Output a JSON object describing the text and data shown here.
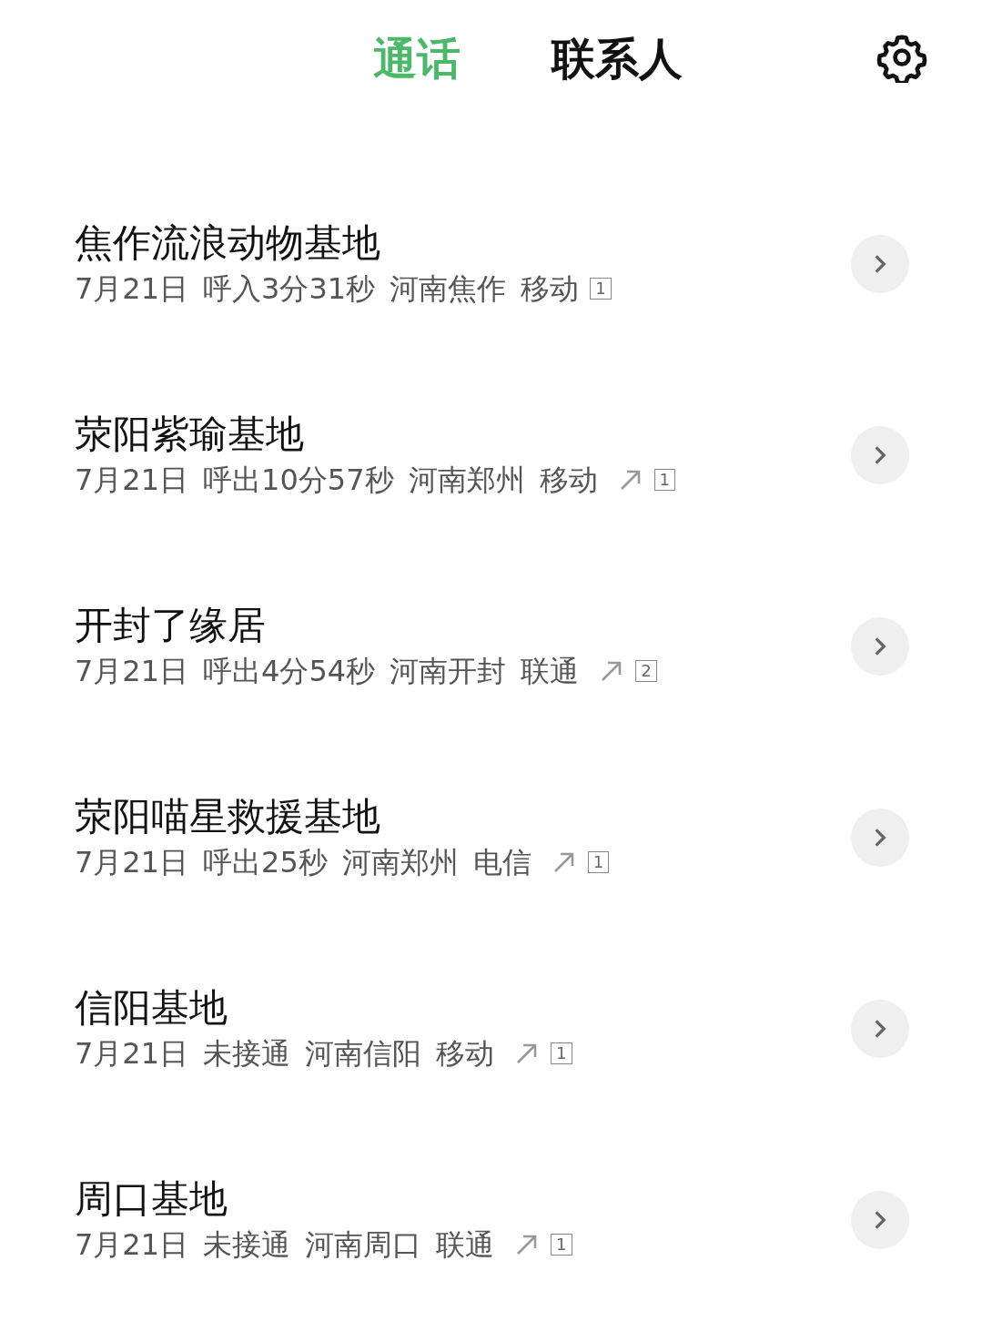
{
  "tabs": [
    {
      "label": "通话",
      "selected": true
    },
    {
      "label": "联系人",
      "selected": false
    }
  ],
  "calls": [
    {
      "name": "焦作流浪动物基地",
      "date": "7月21日",
      "status": "呼入3分31秒",
      "location": "河南焦作",
      "carrier": "移动",
      "outgoing": false,
      "sim": "1"
    },
    {
      "name": "荥阳紫瑜基地",
      "date": "7月21日",
      "status": "呼出10分57秒",
      "location": "河南郑州",
      "carrier": "移动",
      "outgoing": true,
      "sim": "1"
    },
    {
      "name": "开封了缘居",
      "date": "7月21日",
      "status": "呼出4分54秒",
      "location": "河南开封",
      "carrier": "联通",
      "outgoing": true,
      "sim": "2"
    },
    {
      "name": "荥阳喵星救援基地",
      "date": "7月21日",
      "status": "呼出25秒",
      "location": "河南郑州",
      "carrier": "电信",
      "outgoing": true,
      "sim": "1"
    },
    {
      "name": "信阳基地",
      "date": "7月21日",
      "status": "未接通",
      "location": "河南信阳",
      "carrier": "移动",
      "outgoing": true,
      "sim": "1"
    },
    {
      "name": "周口基地",
      "date": "7月21日",
      "status": "未接通",
      "location": "河南周口",
      "carrier": "联通",
      "outgoing": true,
      "sim": "1"
    }
  ]
}
